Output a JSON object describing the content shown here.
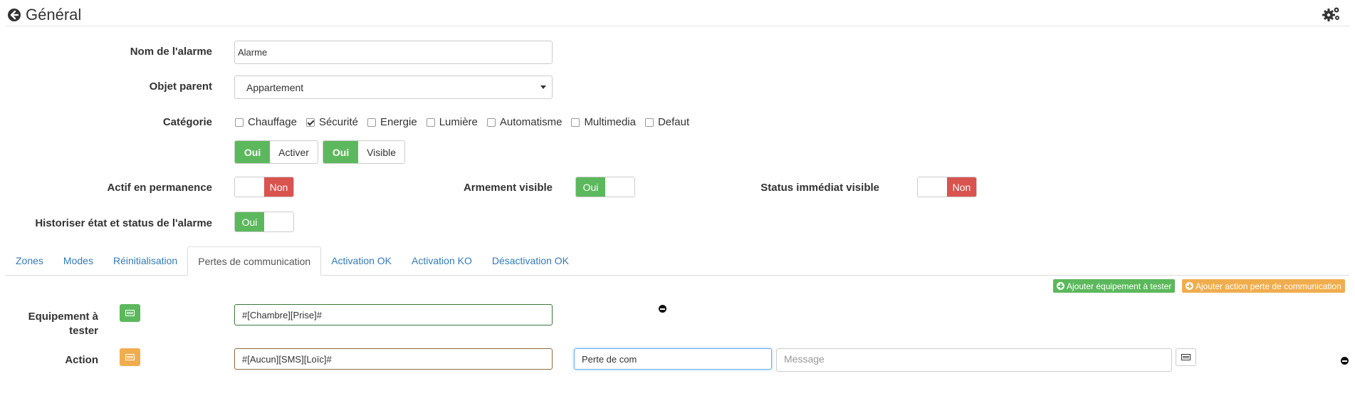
{
  "header": {
    "title": "Général",
    "back_icon": "arrow-circle-left-icon",
    "settings_icon": "gears-icon"
  },
  "form": {
    "alarm_name": {
      "label": "Nom de l'alarme",
      "value": "Alarme"
    },
    "parent_object": {
      "label": "Objet parent",
      "value": "Appartement"
    },
    "category": {
      "label": "Catégorie",
      "items": [
        {
          "label": "Chauffage",
          "checked": false
        },
        {
          "label": "Sécurité",
          "checked": true
        },
        {
          "label": "Energie",
          "checked": false
        },
        {
          "label": "Lumière",
          "checked": false
        },
        {
          "label": "Automatisme",
          "checked": false
        },
        {
          "label": "Multimedia",
          "checked": false
        },
        {
          "label": "Defaut",
          "checked": false
        }
      ]
    },
    "activate": {
      "on": "Oui",
      "label": "Activer"
    },
    "visible": {
      "on": "Oui",
      "label": "Visible"
    },
    "permanent": {
      "label": "Actif en permanence",
      "state": "Non"
    },
    "arming_visible": {
      "label": "Armement visible",
      "state": "Oui"
    },
    "status_visible": {
      "label": "Status immédiat visible",
      "state": "Non"
    },
    "history": {
      "label": "Historiser état et status de l'alarme",
      "state": "Oui"
    }
  },
  "tabs": [
    {
      "label": "Zones",
      "active": false
    },
    {
      "label": "Modes",
      "active": false
    },
    {
      "label": "Réinitialisation",
      "active": false
    },
    {
      "label": "Pertes de communication",
      "active": true
    },
    {
      "label": "Activation OK",
      "active": false
    },
    {
      "label": "Activation KO",
      "active": false
    },
    {
      "label": "Désactivation OK",
      "active": false
    }
  ],
  "actions": {
    "add_equipment": "Ajouter équipement à tester",
    "add_action": "Ajouter action perte de communication"
  },
  "equipment": {
    "label": "Equipement à tester",
    "value": "#[Chambre][Prise]#"
  },
  "action": {
    "label": "Action",
    "cmd_value": "#[Aucun][SMS][Loïc]#",
    "title_value": "Perte de com",
    "message_placeholder": "Message"
  },
  "colors": {
    "green": "#5cb85c",
    "red": "#d9534f",
    "orange": "#f0ad4e",
    "link": "#337ab7"
  }
}
